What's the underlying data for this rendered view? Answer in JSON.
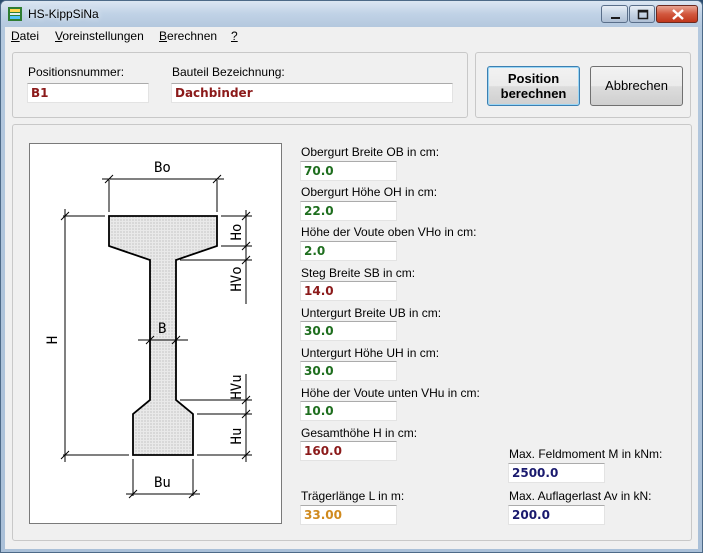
{
  "window": {
    "title": "HS-KippSiNa"
  },
  "menu": [
    {
      "label_u": "D",
      "label_rest": "atei"
    },
    {
      "label_u": "V",
      "label_rest": "oreinstellungen"
    },
    {
      "label_u": "B",
      "label_rest": "erechnen"
    },
    {
      "label_u": "?",
      "label_rest": ""
    }
  ],
  "header": {
    "position_label": "Positionsnummer:",
    "position_value": "B1",
    "component_label": "Bauteil Bezeichnung:",
    "component_value": "Dachbinder"
  },
  "buttons": {
    "calc_line1": "Position",
    "calc_line2": "berechnen",
    "cancel": "Abbrechen"
  },
  "drawing": {
    "dim_bo": "Bo",
    "dim_ho": "Ho",
    "dim_hvo": "HVo",
    "dim_h": "H",
    "dim_b": "B",
    "dim_hvu": "HVu",
    "dim_hu": "Hu",
    "dim_bu": "Bu"
  },
  "fields": [
    {
      "label": "Obergurt Breite OB in cm:",
      "value": "70.0"
    },
    {
      "label": "Obergurt Höhe OH in cm:",
      "value": "22.0"
    },
    {
      "label": "Höhe der Voute oben VHo in cm:",
      "value": "2.0"
    },
    {
      "label": "Steg Breite SB in cm:",
      "value": "14.0"
    },
    {
      "label": "Untergurt Breite UB in cm:",
      "value": "30.0"
    },
    {
      "label": "Untergurt Höhe UH in cm:",
      "value": "30.0"
    },
    {
      "label": "Höhe der Voute unten VHu in cm:",
      "value": "10.0"
    },
    {
      "label": "Gesamthöhe H in cm:",
      "value": "160.0"
    },
    {
      "label": "Trägerlänge L in m:",
      "value": "33.00"
    },
    {
      "label": "Max. Feldmoment M in kNm:",
      "value": "2500.0"
    },
    {
      "label": "Max. Auflagerlast Av in kN:",
      "value": "200.0"
    }
  ],
  "colors": {
    "value_red": "#8b1a1a",
    "value_green": "#1e6e1e",
    "value_orange": "#d08a1e",
    "value_navy": "#1a1a6e",
    "close_button": "#c0371c"
  }
}
